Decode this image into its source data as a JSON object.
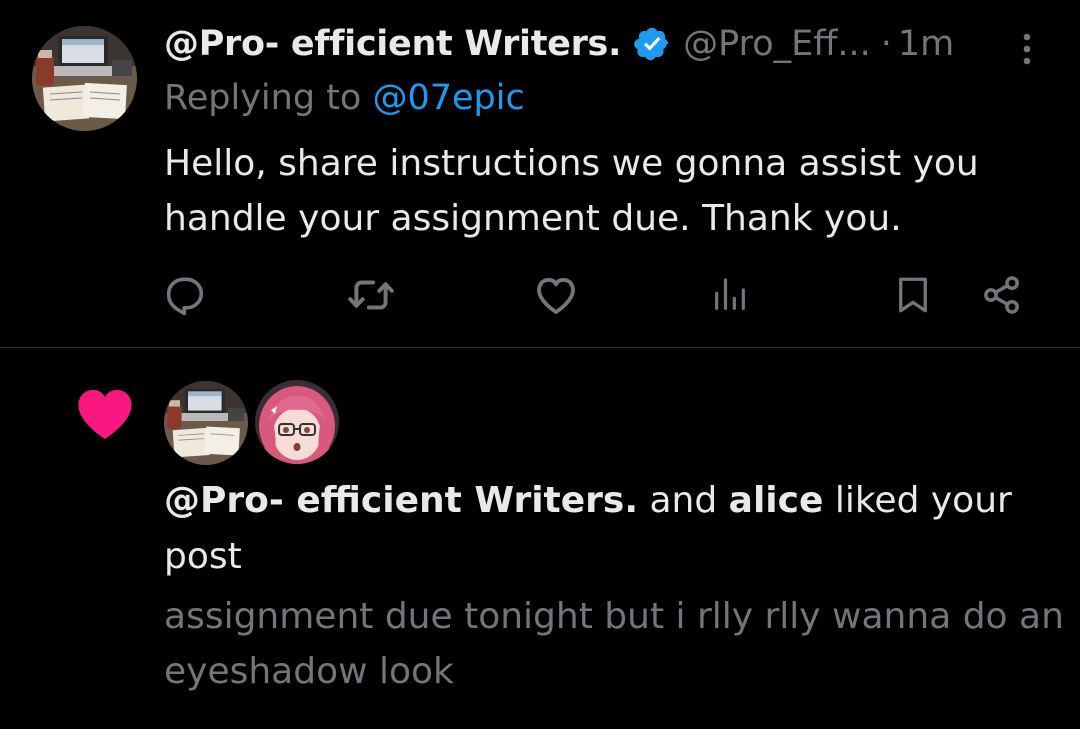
{
  "reply": {
    "author_name": "@Pro- efficient Writers.",
    "author_handle": "@Pro_Eff...",
    "separator": "·",
    "time": "1m",
    "replying_label": "Replying to",
    "replying_to": "@07epic",
    "text": "Hello, share instructions we gonna assist you handle your assignment due. Thank you.",
    "actions": [
      "reply-icon",
      "retweet-icon",
      "like-icon",
      "views-icon",
      "bookmark-icon",
      "share-icon"
    ]
  },
  "notification": {
    "user1": "@Pro- efficient Writers.",
    "connector": "and",
    "user2": "alice",
    "action_text": "liked your post",
    "post_text": "assignment due tonight but i rlly rlly wanna do an eyeshadow look"
  },
  "colors": {
    "background": "#000000",
    "text_primary": "#e7e9ea",
    "text_secondary": "#71767b",
    "accent_blue": "#1d9bf0",
    "like_pink": "#f91880",
    "divider": "#2f3336"
  }
}
